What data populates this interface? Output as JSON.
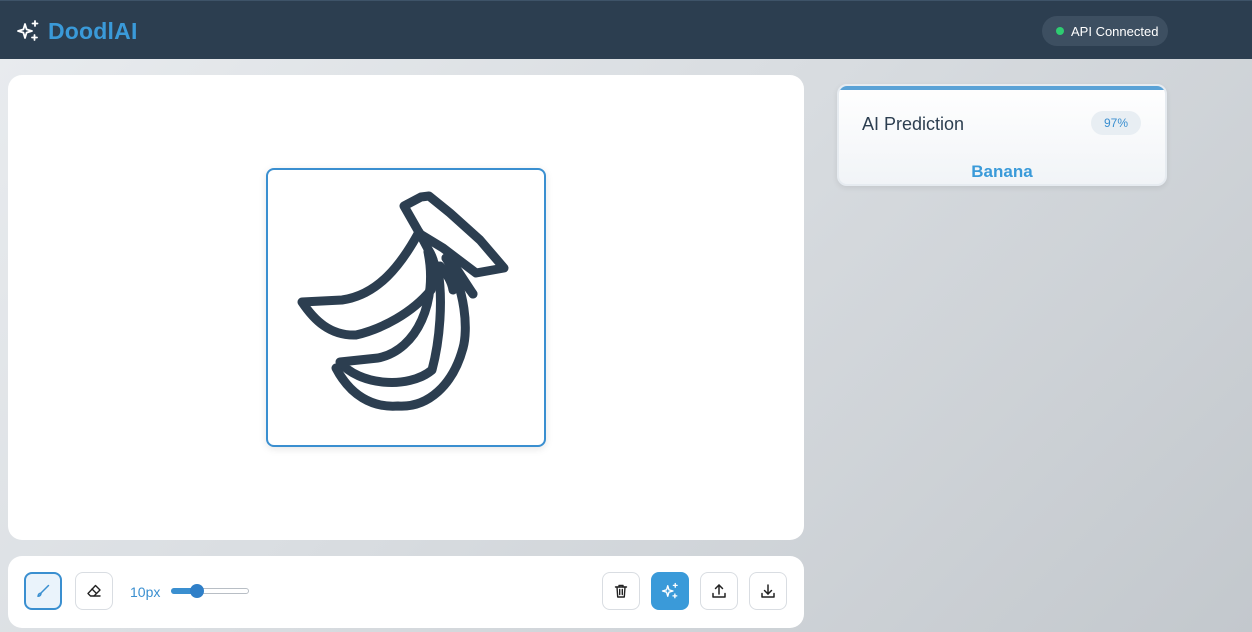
{
  "app": {
    "name": "DoodlAI",
    "brand_icon": "sparkles-icon",
    "brand_color": "#3a9ad9"
  },
  "header": {
    "status_text": "API Connected",
    "status_color": "#2ecc71"
  },
  "canvas": {
    "drawing": "banana doodle",
    "stroke_color": "#2c3e50"
  },
  "toolbar": {
    "tools": [
      {
        "name": "brush",
        "icon": "brush-icon",
        "active": true
      },
      {
        "name": "eraser",
        "icon": "eraser-icon",
        "active": false
      }
    ],
    "brush_size_label": "10px",
    "brush_size_fraction": 0.3,
    "actions": [
      {
        "name": "clear",
        "icon": "trash-icon"
      },
      {
        "name": "predict",
        "icon": "sparkles-icon",
        "primary": true
      },
      {
        "name": "upload",
        "icon": "upload-icon"
      },
      {
        "name": "download",
        "icon": "download-icon"
      }
    ]
  },
  "prediction": {
    "title": "AI Prediction",
    "confidence": "97%",
    "label": "Banana"
  }
}
